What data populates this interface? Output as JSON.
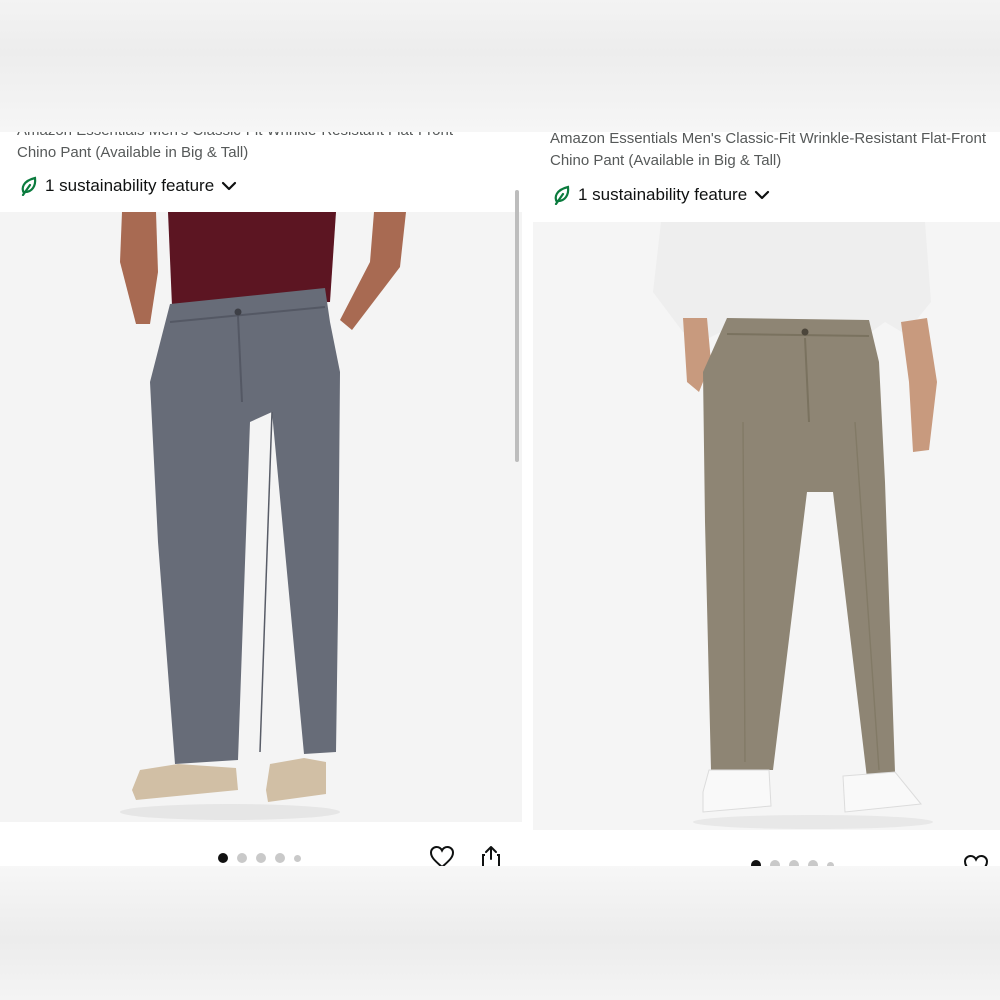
{
  "left_card": {
    "title_partial": "Amazon Essentials Men's Classic-Fit Wrinkle-Resistant Flat-Front",
    "title_line2": "Chino Pant (Available in Big & Tall)",
    "sustainability": "1 sustainability feature",
    "pant_color": "#676c78",
    "image_count": 5,
    "active_image": 1
  },
  "right_card": {
    "title_line1": "Amazon Essentials Men's Classic-Fit Wrinkle-Resistant Flat-Front",
    "title_line2": "Chino Pant (Available in Big & Tall)",
    "sustainability": "1 sustainability feature",
    "pant_color": "#8e8574",
    "image_count": 5,
    "active_image": 1
  },
  "icons": {
    "leaf": "leaf-icon",
    "chevron": "chevron-down-icon",
    "heart": "heart-icon",
    "share": "share-icon"
  },
  "colors": {
    "leaf_green": "#0b7b3e",
    "text_dark": "#0f1111",
    "text_gray": "#565959"
  }
}
